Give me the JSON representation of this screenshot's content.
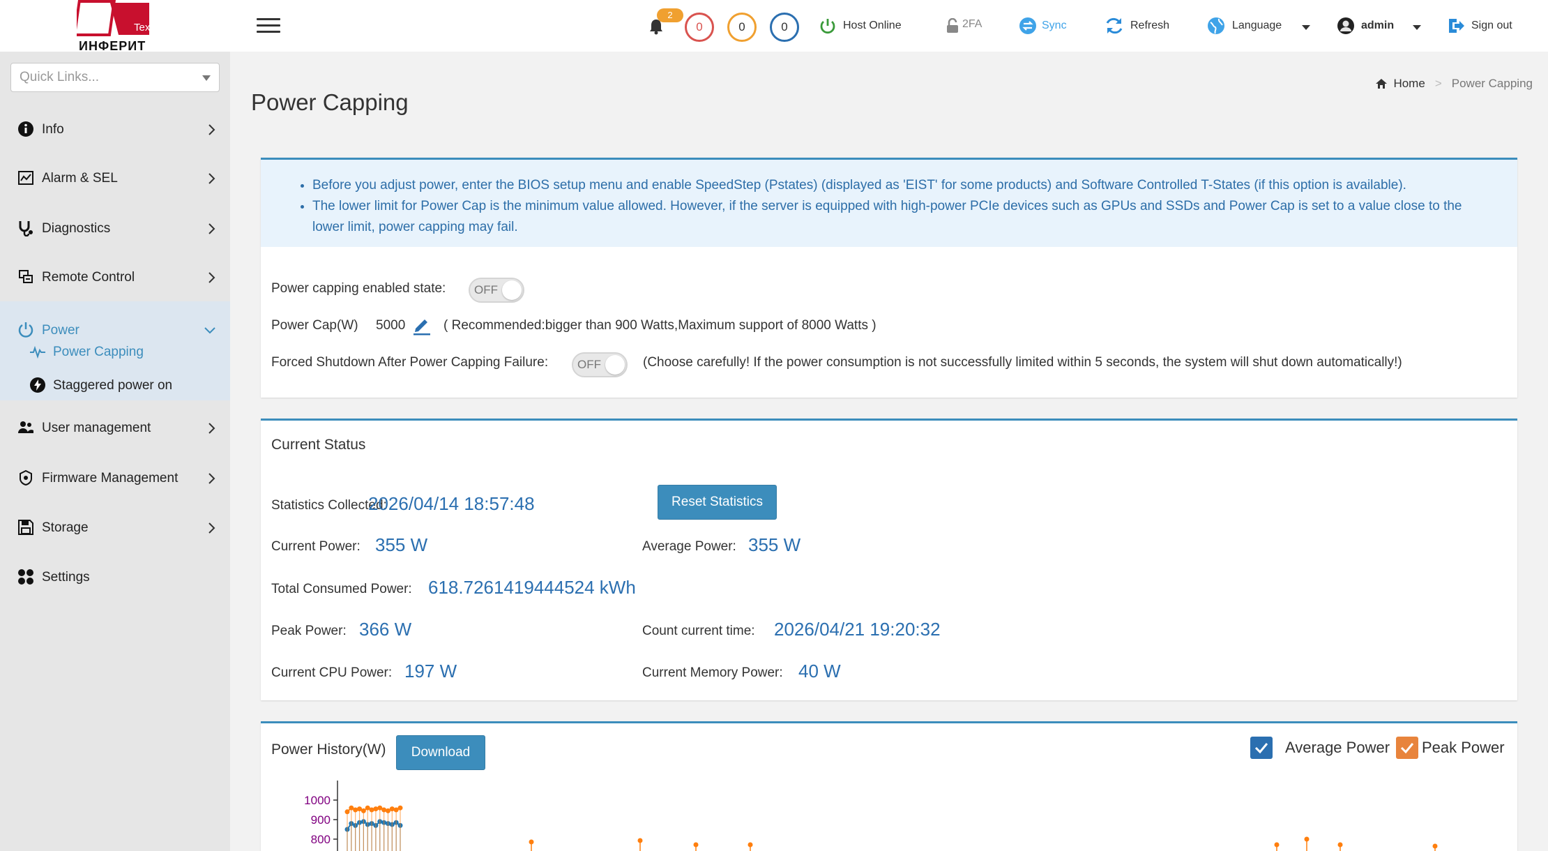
{
  "brand": {
    "logo_text": "ИНФЕРИТ",
    "logo_tag": "Tex",
    "accent": "#c8102e"
  },
  "quick_links": {
    "placeholder": "Quick Links..."
  },
  "sidebar": {
    "items": [
      {
        "label": "Info"
      },
      {
        "label": "Alarm & SEL"
      },
      {
        "label": "Diagnostics"
      },
      {
        "label": "Remote Control"
      },
      {
        "label": "Power"
      },
      {
        "label": "User management"
      },
      {
        "label": "Firmware Management"
      },
      {
        "label": "Storage"
      },
      {
        "label": "Settings"
      }
    ],
    "power_sub": [
      {
        "label": "Power Capping"
      },
      {
        "label": "Staggered power on"
      }
    ]
  },
  "topbar": {
    "notifications": "2",
    "critical": "0",
    "warning": "0",
    "info": "0",
    "host_status": "Host Online",
    "twofa": "2FA",
    "sync": "Sync",
    "refresh": "Refresh",
    "language": "Language",
    "user": "admin",
    "signout": "Sign out"
  },
  "page": {
    "title": "Power Capping",
    "breadcrumb_home": "Home",
    "breadcrumb_sep": ">",
    "breadcrumb_current": "Power Capping"
  },
  "notes": [
    "Before you adjust power, enter the BIOS setup menu and enable SpeedStep (Pstates) (displayed as 'EIST' for some products) and Software Controlled T-States (if this option is available).",
    "The lower limit for Power Cap is the minimum value allowed. However, if the server is equipped with high-power PCIe devices such as GPUs and SSDs and Power Cap is set to a value close to the lower limit, power capping may fail."
  ],
  "settings": {
    "enabled_label": "Power capping enabled state:",
    "enabled_state": "OFF",
    "cap_label": "Power Cap(W)",
    "cap_value": "5000",
    "cap_hint": "( Recommended:bigger than 900 Watts,Maximum support of 8000 Watts )",
    "forced_label": "Forced Shutdown After Power Capping Failure:",
    "forced_state": "OFF",
    "forced_hint": "(Choose carefully! If the power consumption is not successfully limited within 5 seconds, the system will shut down automatically!)"
  },
  "status": {
    "title": "Current Status",
    "collected_label": "Statistics Collected:",
    "collected_value": "2026/04/14 18:57:48",
    "reset_button": "Reset Statistics",
    "current_label": "Current Power:",
    "current_value": "355 W",
    "average_label": "Average Power:",
    "average_value": "355 W",
    "total_label": "Total Consumed Power:",
    "total_value": "618.7261419444524 kWh",
    "peak_label": "Peak Power:",
    "peak_value": "366 W",
    "count_label": "Count current time:",
    "count_value": "2026/04/21 19:20:32",
    "cpu_label": "Current CPU Power:",
    "cpu_value": "197 W",
    "mem_label": "Current Memory Power:",
    "mem_value": "40 W"
  },
  "history": {
    "title": "Power History(W)",
    "download_button": "Download",
    "legend_average": "Average Power",
    "legend_peak": "Peak Power",
    "average_color": "#1f77b4",
    "peak_color": "#ff7f0e"
  },
  "chart_data": {
    "type": "line",
    "ylim": [
      800,
      1020
    ],
    "yticks": [
      "1000",
      "900",
      "800"
    ],
    "series": [
      {
        "name": "Average Power",
        "values": [
          850,
          880,
          870,
          885,
          890,
          875,
          880,
          870,
          890,
          885,
          880,
          875,
          885,
          870
        ]
      },
      {
        "name": "Peak Power",
        "values": [
          940,
          960,
          950,
          955,
          945,
          960,
          950,
          955,
          960,
          950,
          945,
          955,
          950,
          960
        ]
      }
    ]
  }
}
